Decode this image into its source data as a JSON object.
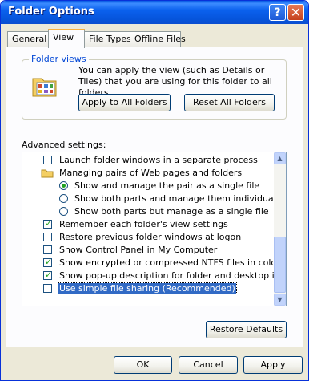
{
  "window": {
    "title": "Folder Options",
    "help_glyph": "?",
    "close_glyph": "✕"
  },
  "tabs": [
    {
      "label": "General"
    },
    {
      "label": "View"
    },
    {
      "label": "File Types"
    },
    {
      "label": "Offline Files"
    }
  ],
  "folder_views": {
    "legend": "Folder views",
    "description": "You can apply the view (such as Details or Tiles) that you are using for this folder to all folders.",
    "apply_label": "Apply to All Folders",
    "reset_label": "Reset All Folders"
  },
  "advanced": {
    "label": "Advanced settings:",
    "items": [
      {
        "type": "checkbox",
        "checked": false,
        "label": "Launch folder windows in a separate process"
      },
      {
        "type": "folder",
        "label": "Managing pairs of Web pages and folders"
      },
      {
        "type": "radio",
        "checked": true,
        "label": "Show and manage the pair as a single file"
      },
      {
        "type": "radio",
        "checked": false,
        "label": "Show both parts and manage them individually"
      },
      {
        "type": "radio",
        "checked": false,
        "label": "Show both parts but manage as a single file"
      },
      {
        "type": "checkbox",
        "checked": true,
        "label": "Remember each folder's view settings"
      },
      {
        "type": "checkbox",
        "checked": false,
        "label": "Restore previous folder windows at logon"
      },
      {
        "type": "checkbox",
        "checked": false,
        "label": "Show Control Panel in My Computer"
      },
      {
        "type": "checkbox",
        "checked": true,
        "label": "Show encrypted or compressed NTFS files in color"
      },
      {
        "type": "checkbox",
        "checked": true,
        "label": "Show pop-up description for folder and desktop items"
      },
      {
        "type": "checkbox",
        "checked": false,
        "label": "Use simple file sharing (Recommended)",
        "selected": true
      }
    ],
    "restore_label": "Restore Defaults"
  },
  "footer": {
    "ok_label": "OK",
    "cancel_label": "Cancel",
    "apply_label": "Apply"
  },
  "colors": {
    "title_bar": "#0a5be4",
    "selection": "#316ac5",
    "check": "#21a121"
  }
}
